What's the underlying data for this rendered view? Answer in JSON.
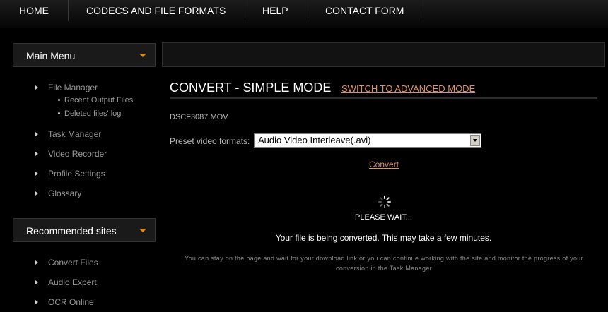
{
  "nav": {
    "items": [
      {
        "label": "HOME"
      },
      {
        "label": "CODECS AND FILE FORMATS"
      },
      {
        "label": "HELP"
      },
      {
        "label": "CONTACT FORM"
      }
    ]
  },
  "sidebar": {
    "main_menu": {
      "title": "Main Menu",
      "items": [
        {
          "label": "File Manager",
          "subitems": [
            {
              "label": "Recent Output Files"
            },
            {
              "label": "Deleted files' log"
            }
          ]
        },
        {
          "label": "Task Manager"
        },
        {
          "label": "Video Recorder"
        },
        {
          "label": "Profile Settings"
        },
        {
          "label": "Glossary"
        }
      ]
    },
    "recommended": {
      "title": "Recommended sites",
      "items": [
        {
          "label": "Convert Files"
        },
        {
          "label": "Audio Expert"
        },
        {
          "label": "OCR Online"
        }
      ]
    }
  },
  "main": {
    "title": "CONVERT - SIMPLE MODE",
    "mode_link": "SWITCH TO ADVANCED MODE",
    "filename": "DSCF3087.MOV",
    "preset_label": "Preset video formats:",
    "preset_value": "Audio Video Interleave(.avi)",
    "convert_link": "Convert",
    "wait_text": "PLEASE WAIT...",
    "converting_text": "Your file is being converted. This may take a few minutes.",
    "info_text": "You can stay on the page and wait for your download link or you can continue working with the site and monitor the progress of your conversion in the Task Manager"
  },
  "colors": {
    "accent": "#e08a1e",
    "link": "#e0905c",
    "background": "#000000"
  }
}
